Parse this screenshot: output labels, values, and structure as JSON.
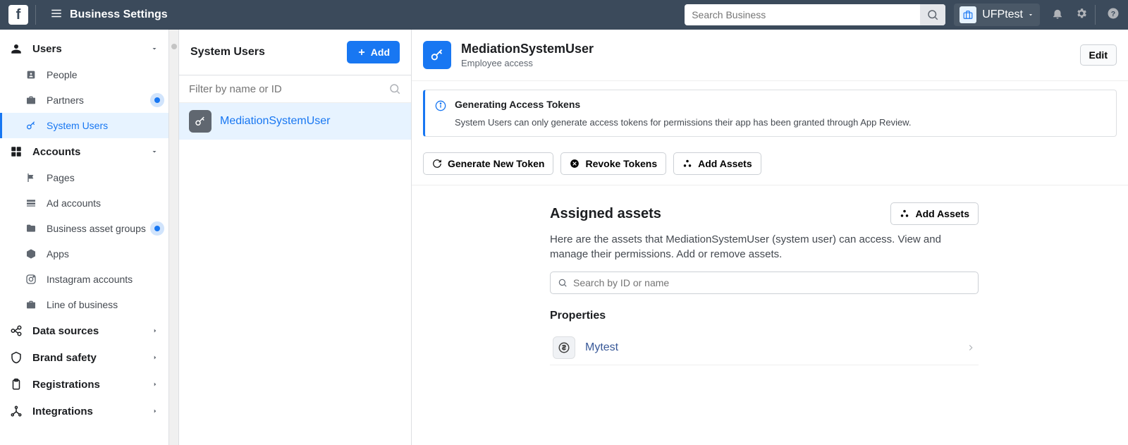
{
  "topbar": {
    "title": "Business Settings",
    "search_placeholder": "Search Business",
    "account_name": "UFPtest"
  },
  "sidebar": {
    "sections": [
      {
        "id": "users",
        "label": "Users",
        "expanded": true,
        "items": [
          {
            "id": "people",
            "label": "People",
            "icon": "badge"
          },
          {
            "id": "partners",
            "label": "Partners",
            "icon": "briefcase",
            "pulse": true
          },
          {
            "id": "system-users",
            "label": "System Users",
            "icon": "key",
            "active": true
          }
        ]
      },
      {
        "id": "accounts",
        "label": "Accounts",
        "expanded": true,
        "items": [
          {
            "id": "pages",
            "label": "Pages",
            "icon": "flag"
          },
          {
            "id": "ad-accounts",
            "label": "Ad accounts",
            "icon": "grid"
          },
          {
            "id": "business-asset-groups",
            "label": "Business asset groups",
            "icon": "folder",
            "pulse": true
          },
          {
            "id": "apps",
            "label": "Apps",
            "icon": "box"
          },
          {
            "id": "instagram",
            "label": "Instagram accounts",
            "icon": "instagram"
          },
          {
            "id": "lob",
            "label": "Line of business",
            "icon": "briefcase"
          }
        ]
      },
      {
        "id": "data-sources",
        "label": "Data sources",
        "collapsed": true
      },
      {
        "id": "brand-safety",
        "label": "Brand safety",
        "collapsed": true
      },
      {
        "id": "registrations",
        "label": "Registrations",
        "collapsed": true
      },
      {
        "id": "integrations",
        "label": "Integrations",
        "collapsed": true
      }
    ]
  },
  "midcol": {
    "title": "System Users",
    "add_label": "Add",
    "filter_placeholder": "Filter by name or ID",
    "items": [
      {
        "id": "msu",
        "name": "MediationSystemUser",
        "active": true
      }
    ]
  },
  "main": {
    "title": "MediationSystemUser",
    "subtitle": "Employee access",
    "edit_label": "Edit",
    "info": {
      "title": "Generating Access Tokens",
      "body": "System Users can only generate access tokens for permissions their app has been granted through App Review."
    },
    "actions": {
      "generate": "Generate New Token",
      "revoke": "Revoke Tokens",
      "add_assets": "Add Assets"
    },
    "assets": {
      "heading": "Assigned assets",
      "add_label": "Add Assets",
      "description": "Here are the assets that MediationSystemUser (system user) can access. View and manage their permissions. Add or remove assets.",
      "search_placeholder": "Search by ID or name",
      "groups": [
        {
          "label": "Properties",
          "items": [
            {
              "id": "mytest",
              "name": "Mytest"
            }
          ]
        }
      ]
    }
  }
}
